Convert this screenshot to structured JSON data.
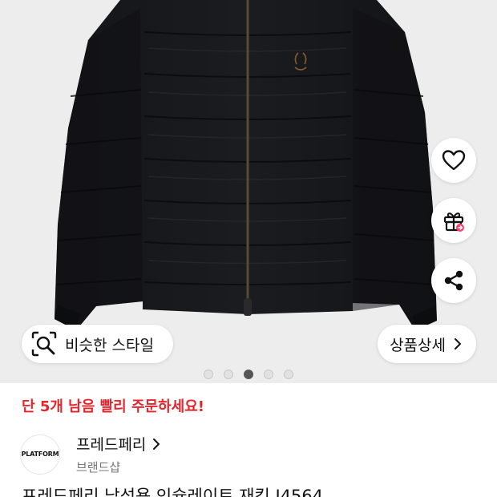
{
  "hero": {
    "icons": [
      "heart-icon",
      "gift-icon",
      "share-icon"
    ],
    "similar_button_label": "비슷한 스타일",
    "detail_button_label": "상품상세",
    "carousel": {
      "total": 5,
      "active_index": 3
    }
  },
  "info": {
    "stock_notice": "단 5개 남음 빨리 주문하세요!",
    "stock_color": "#e4252c",
    "brand": {
      "logo_text": "PLATFORM",
      "name": "프레드페리",
      "subtitle": "브랜드샵"
    },
    "product_title": "프레드페리 남성용 인슐레이트 재킷 J4564"
  }
}
